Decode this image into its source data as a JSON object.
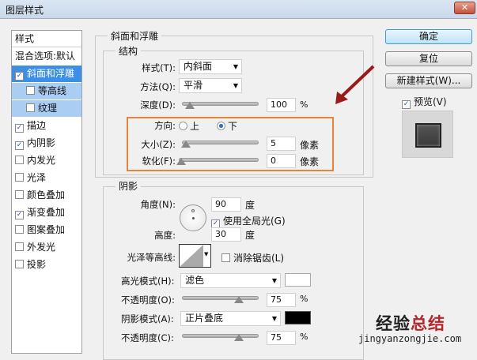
{
  "window": {
    "title": "图层样式",
    "close": "✕"
  },
  "sidebar": {
    "header": "样式",
    "items": [
      {
        "label": "混合选项:默认"
      },
      {
        "label": "斜面和浮雕",
        "checked": true
      },
      {
        "label": "等高线",
        "checked": false
      },
      {
        "label": "纹理",
        "checked": false
      },
      {
        "label": "描边",
        "checked": true
      },
      {
        "label": "内阴影",
        "checked": true
      },
      {
        "label": "内发光",
        "checked": false
      },
      {
        "label": "光泽",
        "checked": false
      },
      {
        "label": "颜色叠加",
        "checked": false
      },
      {
        "label": "渐变叠加",
        "checked": true
      },
      {
        "label": "图案叠加",
        "checked": false
      },
      {
        "label": "外发光",
        "checked": false
      },
      {
        "label": "投影",
        "checked": false
      }
    ]
  },
  "bevel": {
    "title": "斜面和浮雕",
    "structure": {
      "title": "结构",
      "style_label": "样式(T):",
      "style_value": "内斜面",
      "technique_label": "方法(Q):",
      "technique_value": "平滑",
      "depth_label": "深度(D):",
      "depth_value": "100",
      "depth_unit": "%",
      "depth_fraction": 0.1,
      "direction_label": "方向:",
      "dir_up": "上",
      "dir_down": "下",
      "size_label": "大小(Z):",
      "size_value": "5",
      "size_unit": "像素",
      "soften_label": "软化(F):",
      "soften_value": "0",
      "soften_unit": "像素"
    }
  },
  "shading": {
    "title": "阴影",
    "angle_label": "角度(N):",
    "angle_value": "90",
    "angle_unit": "度",
    "global_light": "使用全局光(G)",
    "altitude_label": "高度:",
    "altitude_value": "30",
    "altitude_unit": "度",
    "gloss_label": "光泽等高线:",
    "anti_alias": "消除锯齿(L)",
    "highlight_label": "高光模式(H):",
    "highlight_mode": "滤色",
    "highlight_color": "#ffffff",
    "hl_opacity_label": "不透明度(O):",
    "hl_opacity": "75",
    "pct": "%",
    "shadow_label": "阴影模式(A):",
    "shadow_mode": "正片叠底",
    "shadow_color": "#000000",
    "sh_opacity_label": "不透明度(C):",
    "sh_opacity": "75"
  },
  "buttons": {
    "ok": "确定",
    "reset": "复位",
    "new_style": "新建样式(W)...",
    "preview": "预览(V)"
  },
  "watermark": {
    "cn1": "经验",
    "cn2": "总结",
    "url": "jingyanzongjie.com"
  },
  "colors": {
    "highlight_box": "#e8833a",
    "arrow": "#9a1a1a"
  }
}
